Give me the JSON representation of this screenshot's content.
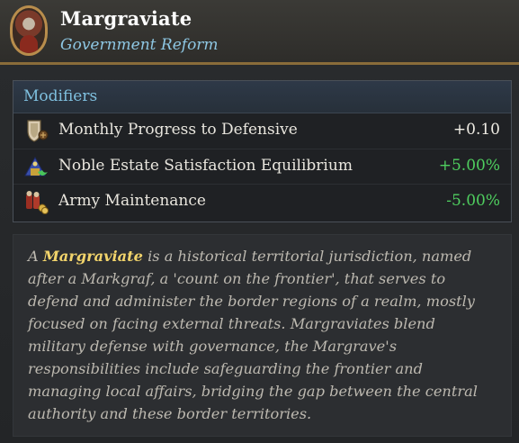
{
  "header": {
    "title": "Margraviate",
    "subtitle": "Government Reform"
  },
  "modifiers": {
    "heading": "Modifiers",
    "rows": [
      {
        "icon": "shield-defensive-icon",
        "label": "Monthly Progress to Defensive",
        "value": "+0.10",
        "color": "#efece4"
      },
      {
        "icon": "noble-estate-icon",
        "label": "Noble Estate Satisfaction Equilibrium",
        "value": "+5.00%",
        "color": "#4fcf5f"
      },
      {
        "icon": "army-maintenance-icon",
        "label": "Army Maintenance",
        "value": "-5.00%",
        "color": "#4fcf5f"
      }
    ]
  },
  "description": {
    "prefix": "A ",
    "highlight": "Margraviate",
    "body": " is a historical territorial jurisdiction, named after a Markgraf, a 'count on the frontier', that serves to defend and administer the border regions of a realm, mostly focused on facing external threats. Margraviates blend military defense with governance, the Margrave's responsibilities include safeguarding the frontier and managing local affairs, bridging the gap between the central authority and these border territories."
  }
}
